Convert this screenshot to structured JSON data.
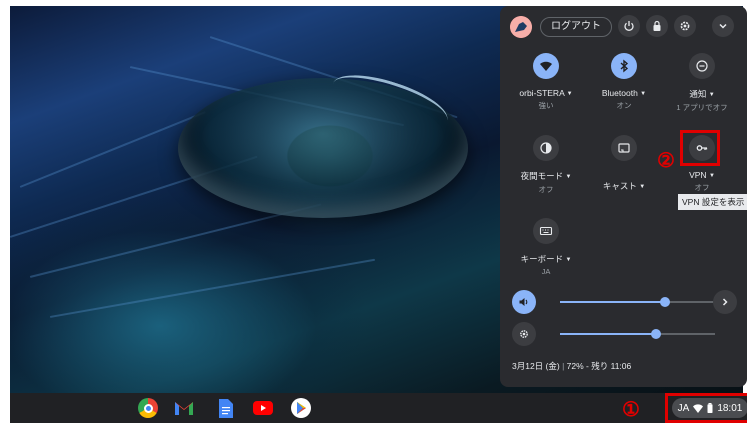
{
  "panel": {
    "logout_label": "ログアウト",
    "tiles": [
      {
        "icon": "wifi-icon",
        "label": "orbi-STERA",
        "sub": "強い",
        "active": true
      },
      {
        "icon": "bluetooth-icon",
        "label": "Bluetooth",
        "sub": "オン",
        "active": true
      },
      {
        "icon": "notification-icon",
        "label": "通知",
        "sub": "1 アプリでオフ",
        "active": false
      },
      {
        "icon": "night-light-icon",
        "label": "夜間モード",
        "sub": "オフ",
        "active": false
      },
      {
        "icon": "cast-icon",
        "label": "キャスト",
        "sub": "",
        "active": false
      },
      {
        "icon": "vpn-key-icon",
        "label": "VPN",
        "sub": "オフ",
        "active": false
      },
      {
        "icon": "keyboard-icon",
        "label": "キーボード",
        "sub": "JA",
        "active": false
      }
    ],
    "tooltip": "VPN 設定を表示",
    "volume_level": 0.68,
    "brightness_level": 0.62,
    "date": "3月12日 (金)",
    "battery": "72% - 残り 11:06"
  },
  "shelf": {
    "apps": [
      "chrome-icon",
      "gmail-icon",
      "docs-icon",
      "youtube-icon",
      "play-store-icon"
    ],
    "status": {
      "ime": "JA",
      "time": "18:01"
    }
  },
  "markers": {
    "one": "①",
    "two": "②"
  },
  "colors": {
    "accent": "#8ab4f8",
    "highlight": "#e00000",
    "panel_bg": "#2a2b2f"
  }
}
